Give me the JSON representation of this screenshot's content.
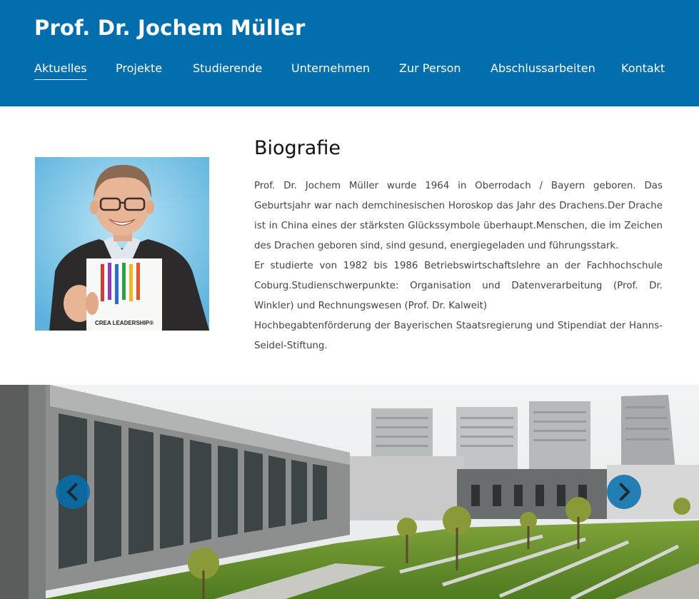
{
  "header": {
    "site_title": "Prof. Dr. Jochem Müller",
    "background_color": "#036ead"
  },
  "nav": {
    "items": [
      {
        "label": "Aktuelles",
        "active": true
      },
      {
        "label": "Projekte"
      },
      {
        "label": "Studierende"
      },
      {
        "label": "Unternehmen"
      },
      {
        "label": "Zur Person"
      },
      {
        "label": "Abschlussarbeiten"
      },
      {
        "label": "Kontakt"
      }
    ]
  },
  "biography": {
    "title": "Biografie",
    "paragraphs": [
      "Prof. Dr. Jochem Müller wurde 1964 in Oberrodach / Bayern geboren. Das Geburtsjahr war nach demchinesischen Horoskop das Jahr des Drachens.Der Drache ist in China eines der stärksten Glückssymbole überhaupt.Menschen, die im Zeichen des Drachen geboren sind, sind gesund, energiegeladen und führungsstark.",
      "Er studierte von 1982 bis 1986 Betriebswirtschaftslehre an der Fachhochschule Coburg.Studienschwerpunkte: Organisation und Datenverarbeitung (Prof. Dr. Winkler) und Rechnungswesen (Prof. Dr. Kalweit)",
      "Hochbegabtenförderung der Bayerischen Staatsregierung und Stipendiat der Hanns-Seidel-Stiftung."
    ]
  },
  "portrait": {
    "book_title": "CREA LEADERSHIP®"
  },
  "carousel": {
    "prev_icon": "chevron-left-icon",
    "next_icon": "chevron-right-icon",
    "button_color": "#036ead"
  }
}
